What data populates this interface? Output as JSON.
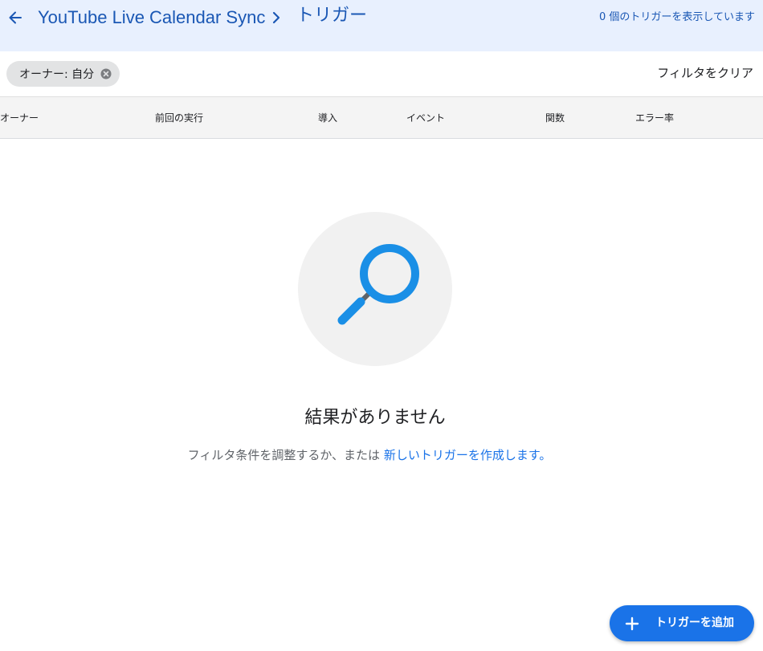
{
  "header": {
    "project_title": "YouTube Live Calendar Sync",
    "page_title": "トリガー",
    "trigger_count_text": "0 個のトリガーを表示しています",
    "back_icon": "arrow-left-icon",
    "separator_icon": "chevron-right-icon"
  },
  "filters": {
    "chip_label": "オーナー: 自分",
    "chip_remove_icon": "cancel-circle-icon",
    "clear_label": "フィルタをクリア"
  },
  "table": {
    "columns": [
      "オーナー",
      "前回の実行",
      "導入",
      "イベント",
      "関数",
      "エラー率"
    ]
  },
  "empty_state": {
    "illustration_icon": "magnifier-icon",
    "title": "結果がありません",
    "desc_prefix": "フィルタ条件を調整するか、または",
    "desc_link": "新しいトリガーを作成します。"
  },
  "fab": {
    "icon": "plus-icon",
    "label": "トリガーを追加"
  },
  "colors": {
    "header_bg": "#e8f0fe",
    "accent": "#1a73e8",
    "title_blue": "#1a57b4",
    "magnifier_blue": "#1a8fe6"
  }
}
